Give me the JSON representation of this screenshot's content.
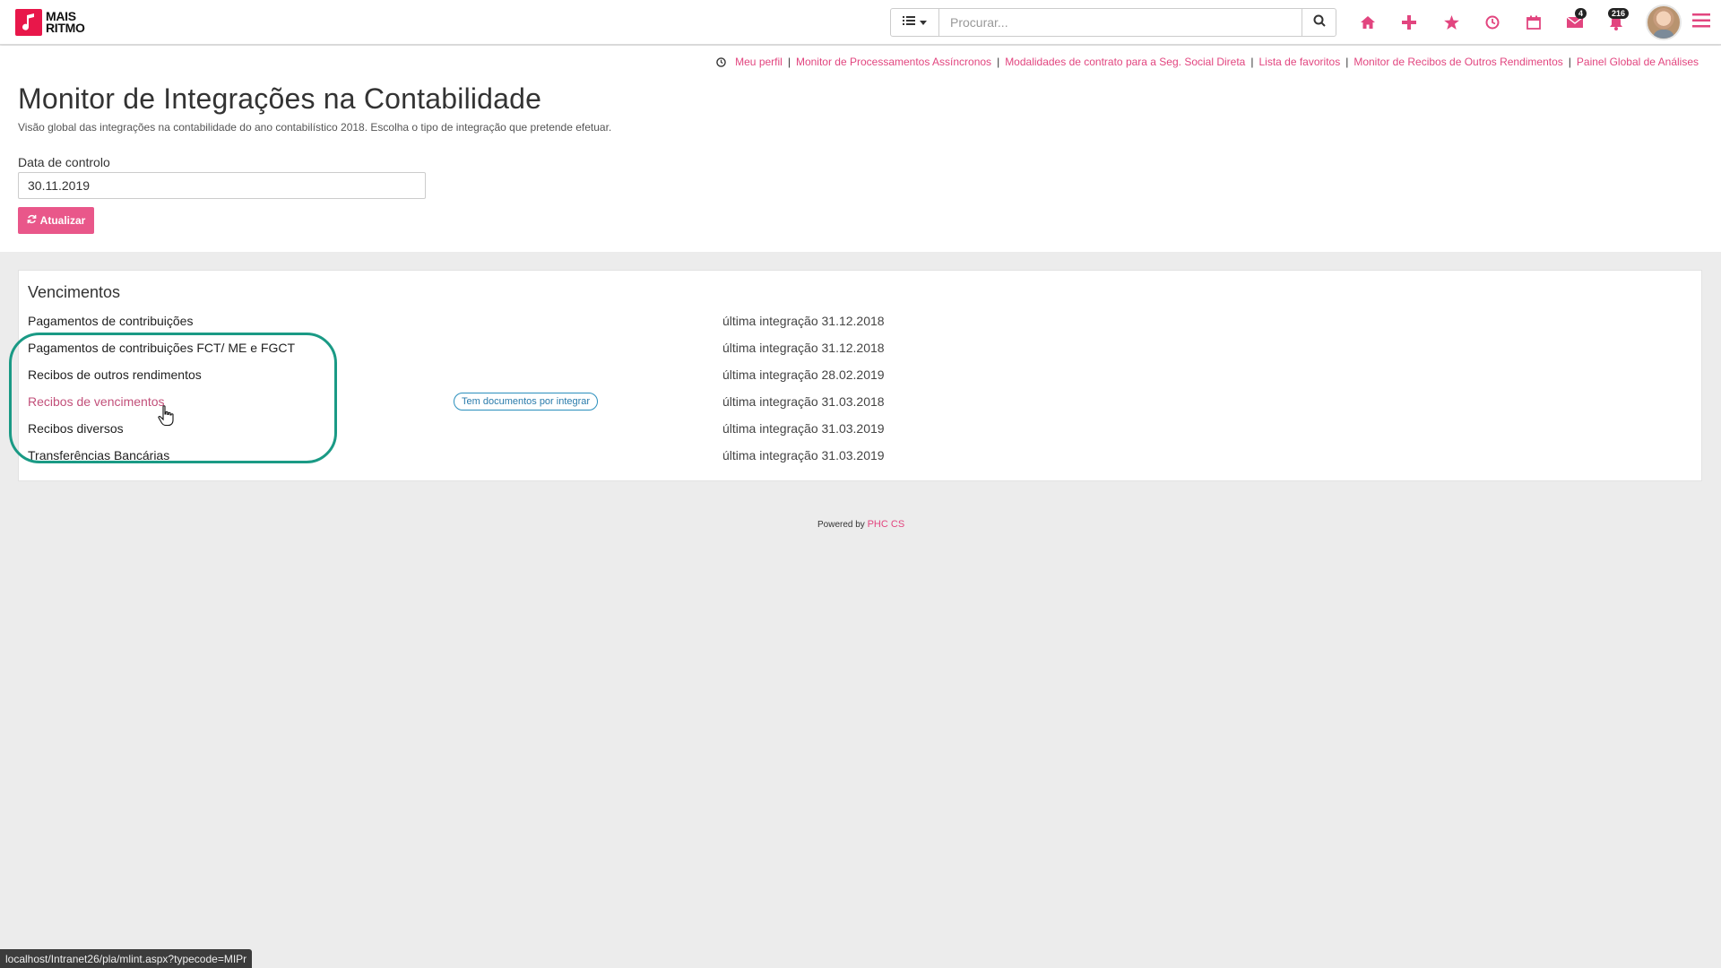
{
  "brand": {
    "logo_line1": "MAIS",
    "logo_line2": "RITMO",
    "accent": "#e8174a",
    "link_color": "#e2457f",
    "highlight_color": "#1a9a85"
  },
  "search": {
    "placeholder": "Procurar...",
    "value": ""
  },
  "navbar": {
    "icons": [
      "home-icon",
      "plus-icon",
      "star-icon",
      "clock-icon",
      "calendar-icon",
      "envelope-icon",
      "bell-icon"
    ],
    "messages_badge": "4",
    "notifications_badge": "216"
  },
  "shortcuts": [
    "Meu perfil",
    "Monitor de Processamentos Assíncronos",
    "Modalidades de contrato para a Seg. Social Direta",
    "Lista de favoritos",
    "Monitor de Recibos de Outros Rendimentos",
    "Painel Global de Análises"
  ],
  "page": {
    "title": "Monitor de Integrações na Contabilidade",
    "subtitle": "Visão global das integrações na contabilidade do ano contabilístico 2018. Escolha o tipo de integração que pretende efetuar.",
    "date_label": "Data de controlo",
    "date_value": "30.11.2019",
    "refresh_label": "Atualizar"
  },
  "panel": {
    "title": "Vencimentos",
    "rows": [
      {
        "label": "Pagamentos de contribuições",
        "date": "última integração 31.12.2018"
      },
      {
        "label": "Pagamentos de contribuições FCT/ ME e FGCT",
        "date": "última integração 31.12.2018"
      },
      {
        "label": "Recibos de outros rendimentos",
        "date": "última integração 28.02.2019"
      },
      {
        "label": "Recibos de vencimentos",
        "date": "última integração 31.03.2018",
        "badge": "Tem documentos por integrar"
      },
      {
        "label": "Recibos diversos",
        "date": "última integração 31.03.2019"
      },
      {
        "label": "Transferências Bancárias",
        "date": "última integração 31.03.2019"
      }
    ]
  },
  "footer": {
    "powered_by": "Powered by",
    "brand": "PHC CS"
  },
  "status_url": "localhost/Intranet26/pla/mlint.aspx?typecode=MIPr"
}
